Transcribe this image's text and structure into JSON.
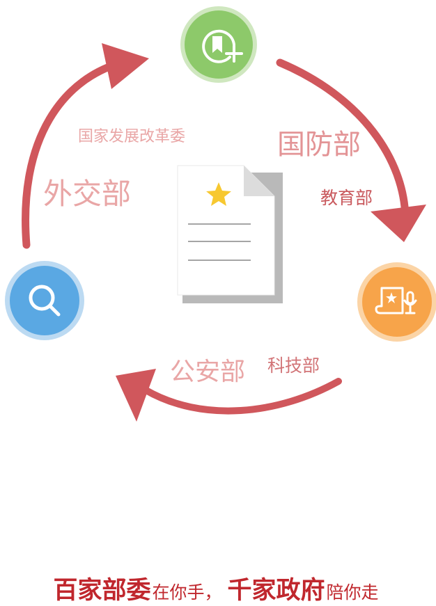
{
  "labels": {
    "fazhan": "国家发展改革委",
    "guofang": "国防部",
    "jiaoyu": "教育部",
    "waijiao": "外交部",
    "gongan": "公安部",
    "keji": "科技部"
  },
  "tagline": {
    "part1": "百家部委",
    "part2": "在你手，",
    "part3": "千家政府",
    "part4": "陪你走"
  },
  "icons": {
    "top": "bookmark-add-icon",
    "left": "search-icon",
    "right": "scroll-microphone-icon",
    "center": "document-star-icon"
  },
  "colors": {
    "arrow": "#d0575c",
    "label_light": "#e9a6a6",
    "label_dark": "#c9595d",
    "green": "#8dc96a",
    "blue": "#5aa8e3",
    "orange": "#f7a44a",
    "star": "#f7c830",
    "tagline": "#c0272d"
  }
}
